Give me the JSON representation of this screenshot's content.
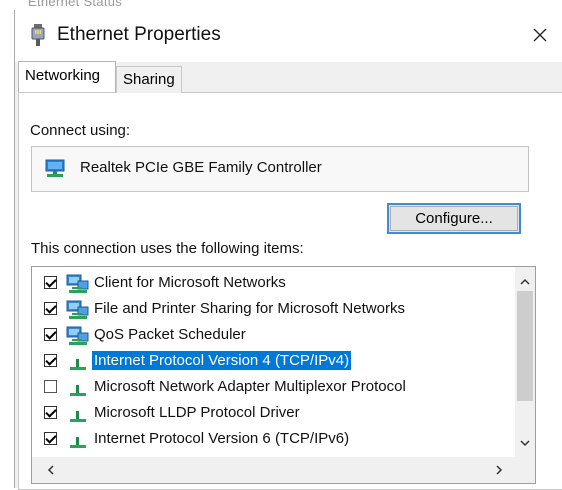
{
  "background_window": {
    "title": "Ethernet Status"
  },
  "dialog": {
    "title": "Ethernet Properties",
    "close_icon": "close-icon"
  },
  "tabs": [
    {
      "label": "Networking",
      "active": true
    },
    {
      "label": "Sharing",
      "active": false
    }
  ],
  "connect": {
    "label": "Connect using:",
    "adapter_name": "Realtek PCIe GBE Family Controller",
    "icon": "network-adapter-icon"
  },
  "configure_label": "Configure...",
  "items_label": "This connection uses the following items:",
  "items": [
    {
      "label": "Client for Microsoft Networks",
      "checked": true,
      "selected": false,
      "icon": "client-network-icon"
    },
    {
      "label": "File and Printer Sharing for Microsoft Networks",
      "checked": true,
      "selected": false,
      "icon": "client-network-icon"
    },
    {
      "label": "QoS Packet Scheduler",
      "checked": true,
      "selected": false,
      "icon": "client-network-icon"
    },
    {
      "label": "Internet Protocol Version 4 (TCP/IPv4)",
      "checked": true,
      "selected": true,
      "icon": "protocol-icon"
    },
    {
      "label": "Microsoft Network Adapter Multiplexor Protocol",
      "checked": false,
      "selected": false,
      "icon": "protocol-icon"
    },
    {
      "label": "Microsoft LLDP Protocol Driver",
      "checked": true,
      "selected": false,
      "icon": "protocol-icon"
    },
    {
      "label": "Internet Protocol Version 6 (TCP/IPv6)",
      "checked": true,
      "selected": false,
      "icon": "protocol-icon"
    }
  ],
  "colors": {
    "selection": "#0078d7",
    "accent_border": "#3c8cd8",
    "dialog_bg": "#f0f0f0"
  }
}
